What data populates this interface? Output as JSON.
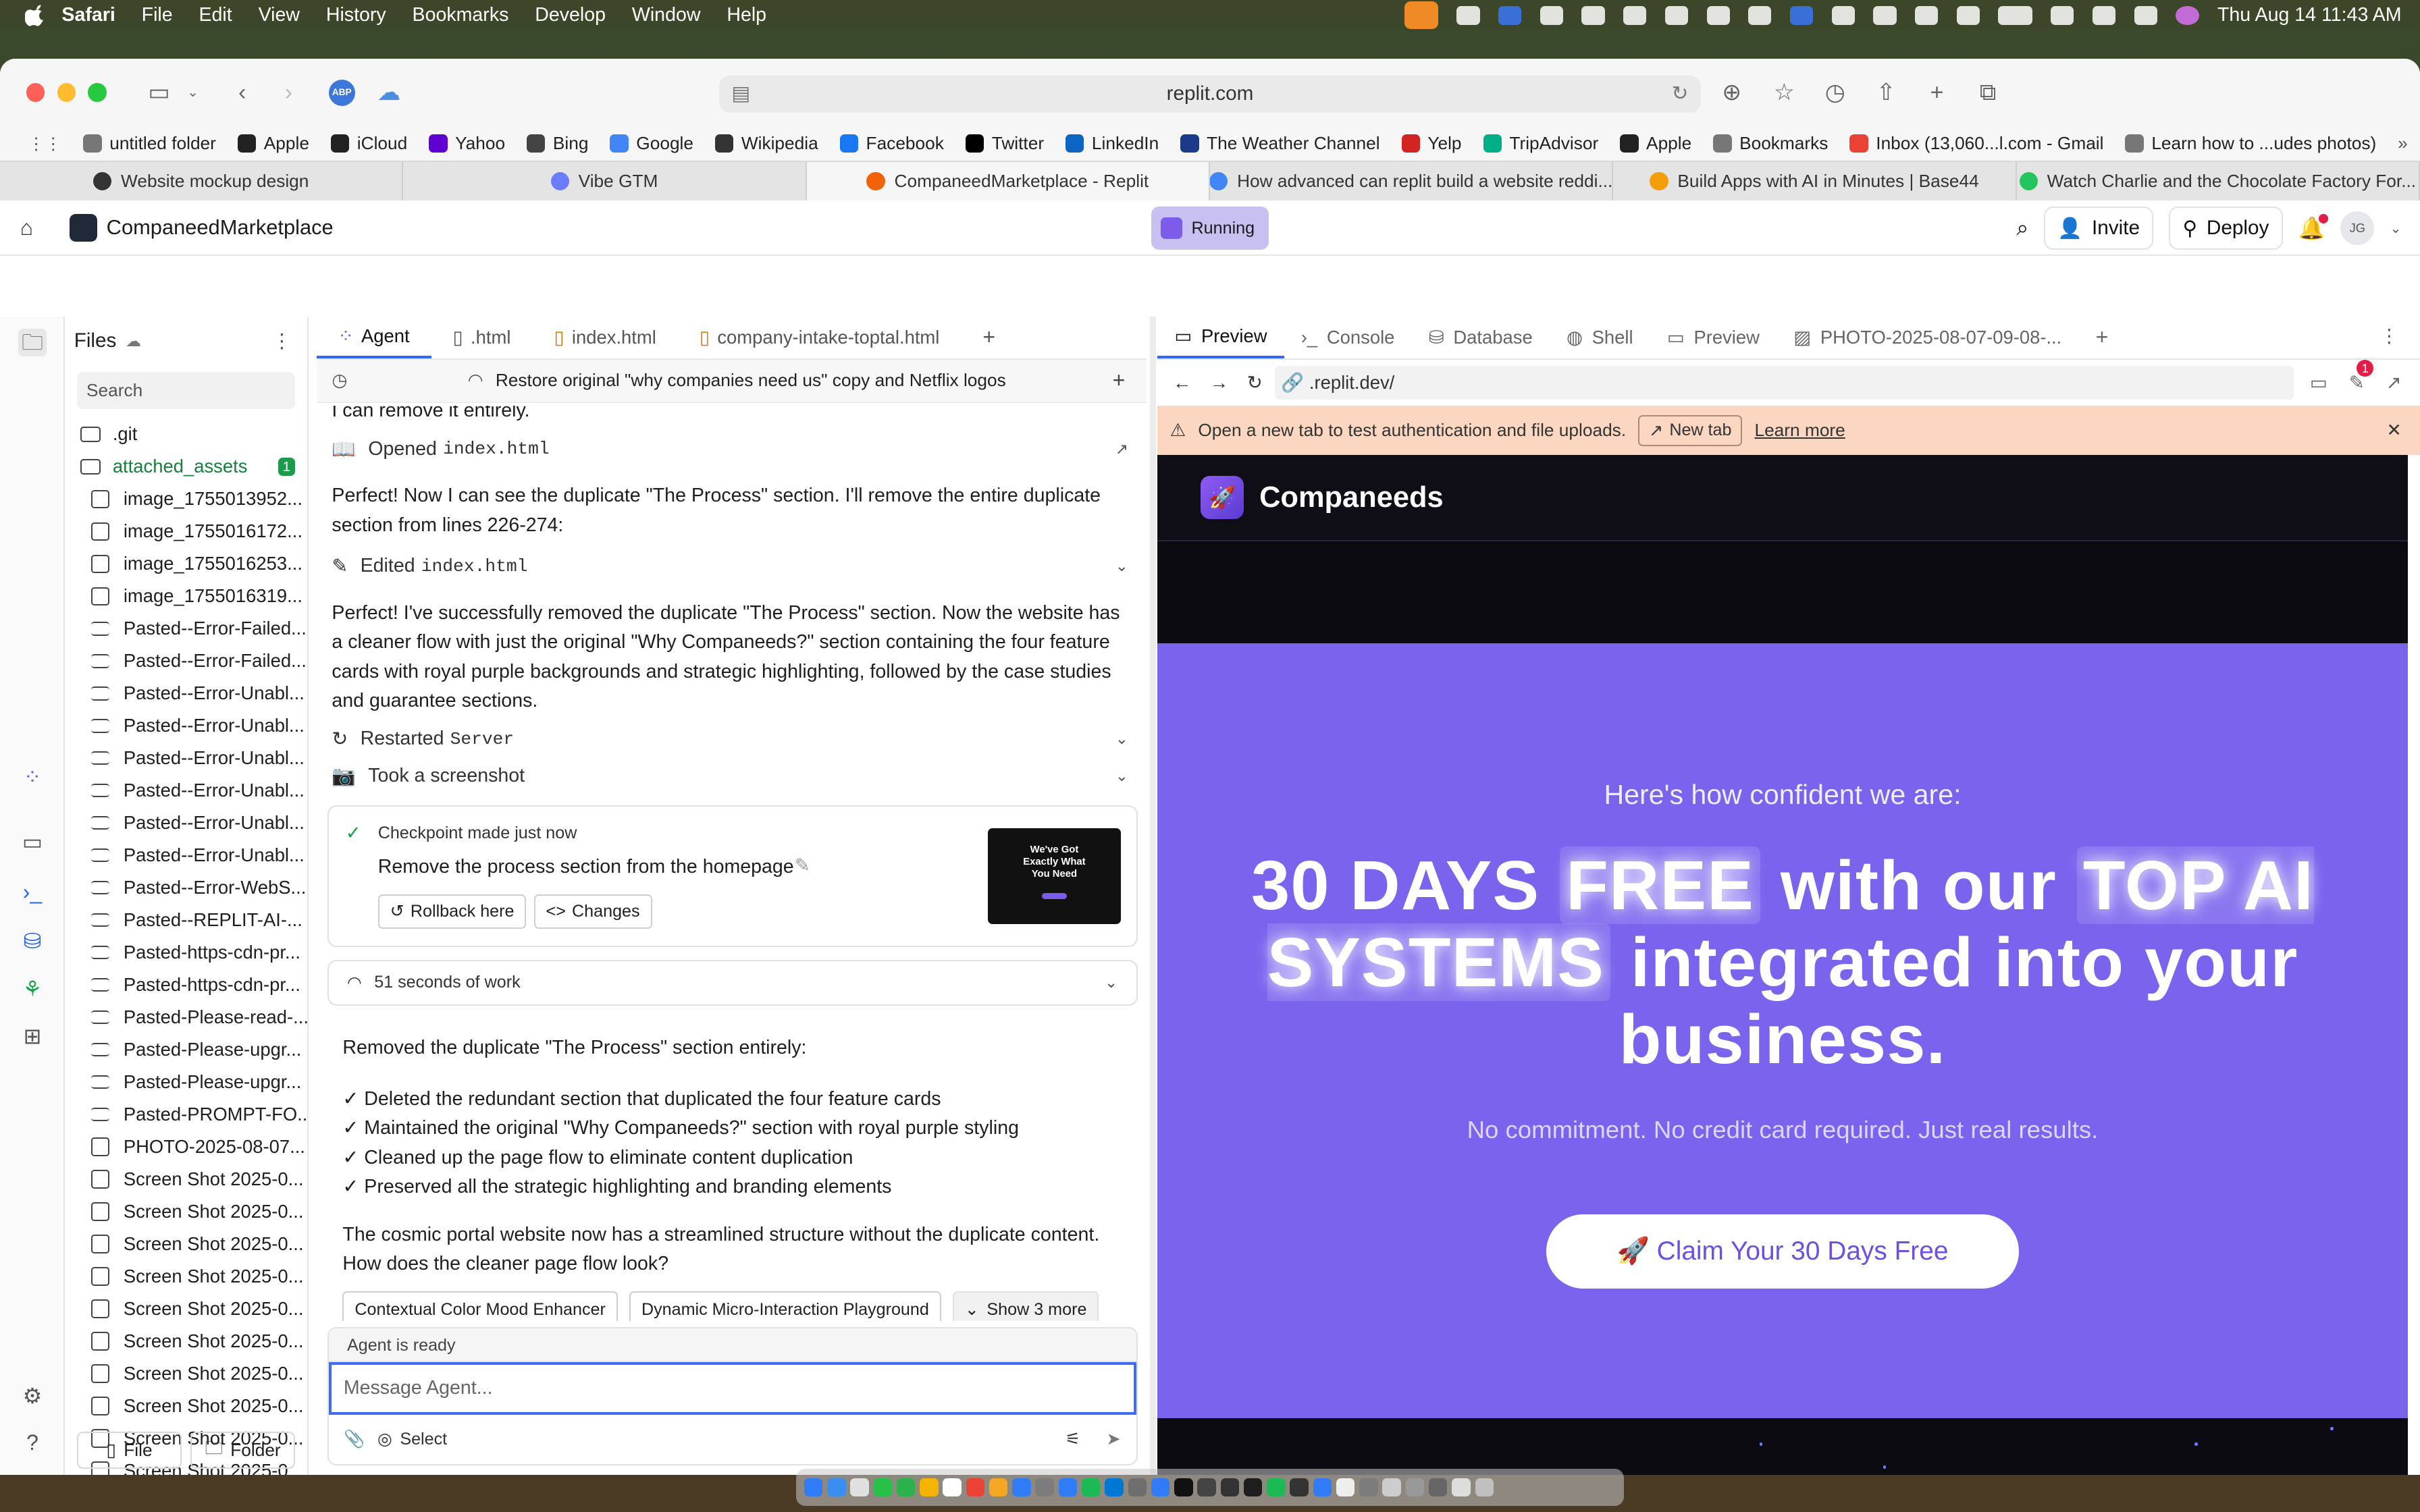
{
  "menubar": {
    "app": "Safari",
    "items": [
      "File",
      "Edit",
      "View",
      "History",
      "Bookmarks",
      "Develop",
      "Window",
      "Help"
    ],
    "clock": "Thu Aug 14  11:43 AM"
  },
  "safari": {
    "address": "replit.com",
    "abp_label": "ABP",
    "bookmarks": [
      {
        "label": "untitled folder",
        "color": "#777777"
      },
      {
        "label": "Apple",
        "color": "#222222"
      },
      {
        "label": "iCloud",
        "color": "#222222"
      },
      {
        "label": "Yahoo",
        "color": "#6001d2"
      },
      {
        "label": "Bing",
        "color": "#444444"
      },
      {
        "label": "Google",
        "color": "#4285f4"
      },
      {
        "label": "Wikipedia",
        "color": "#333333"
      },
      {
        "label": "Facebook",
        "color": "#1877f2"
      },
      {
        "label": "Twitter",
        "color": "#000000"
      },
      {
        "label": "LinkedIn",
        "color": "#0a66c2"
      },
      {
        "label": "The Weather Channel",
        "color": "#1b3a8a"
      },
      {
        "label": "Yelp",
        "color": "#d32323"
      },
      {
        "label": "TripAdvisor",
        "color": "#00af87"
      },
      {
        "label": "Apple",
        "color": "#222222"
      },
      {
        "label": "Bookmarks",
        "color": "#777777"
      },
      {
        "label": "Inbox (13,060...l.com - Gmail",
        "color": "#ea4335"
      },
      {
        "label": "Learn how to ...udes photos)",
        "color": "#777777"
      }
    ],
    "tabs": [
      {
        "label": "Website mockup design",
        "color": "#333333"
      },
      {
        "label": "Vibe GTM",
        "color": "#6b7cff"
      },
      {
        "label": "CompaneedMarketplace - Replit",
        "color": "#f26207"
      },
      {
        "label": "How advanced can replit build a website reddi...",
        "color": "#4285f4"
      },
      {
        "label": "Build Apps with AI in Minutes | Base44",
        "color": "#f59e0b"
      },
      {
        "label": "Watch Charlie and the Chocolate Factory For...",
        "color": "#22c55e"
      }
    ]
  },
  "replit": {
    "project": "CompaneedMarketplace",
    "status": "Running",
    "invite": "Invite",
    "deploy": "Deploy",
    "avatar": "JG",
    "files_title": "Files",
    "search_placeholder": "Search",
    "files": [
      {
        "name": ".git",
        "type": "folder"
      },
      {
        "name": "attached_assets",
        "type": "folder",
        "badge": "1"
      },
      {
        "name": "image_1755013952...",
        "type": "image"
      },
      {
        "name": "image_1755016172...",
        "type": "image"
      },
      {
        "name": "image_1755016253...",
        "type": "image"
      },
      {
        "name": "image_1755016319...",
        "type": "image"
      },
      {
        "name": "Pasted--Error-Failed...",
        "type": "text"
      },
      {
        "name": "Pasted--Error-Failed...",
        "type": "text"
      },
      {
        "name": "Pasted--Error-Unabl...",
        "type": "text"
      },
      {
        "name": "Pasted--Error-Unabl...",
        "type": "text"
      },
      {
        "name": "Pasted--Error-Unabl...",
        "type": "text"
      },
      {
        "name": "Pasted--Error-Unabl...",
        "type": "text"
      },
      {
        "name": "Pasted--Error-Unabl...",
        "type": "text"
      },
      {
        "name": "Pasted--Error-Unabl...",
        "type": "text"
      },
      {
        "name": "Pasted--Error-WebS...",
        "type": "text"
      },
      {
        "name": "Pasted--REPLIT-AI-...",
        "type": "text"
      },
      {
        "name": "Pasted-https-cdn-pr...",
        "type": "text"
      },
      {
        "name": "Pasted-https-cdn-pr...",
        "type": "text"
      },
      {
        "name": "Pasted-Please-read-...",
        "type": "text"
      },
      {
        "name": "Pasted-Please-upgr...",
        "type": "text"
      },
      {
        "name": "Pasted-Please-upgr...",
        "type": "text"
      },
      {
        "name": "Pasted-PROMPT-FO...",
        "type": "text"
      },
      {
        "name": "PHOTO-2025-08-07...",
        "type": "image"
      },
      {
        "name": "Screen Shot 2025-0...",
        "type": "image"
      },
      {
        "name": "Screen Shot 2025-0...",
        "type": "image"
      },
      {
        "name": "Screen Shot 2025-0...",
        "type": "image"
      },
      {
        "name": "Screen Shot 2025-0...",
        "type": "image"
      },
      {
        "name": "Screen Shot 2025-0...",
        "type": "image"
      },
      {
        "name": "Screen Shot 2025-0...",
        "type": "image"
      },
      {
        "name": "Screen Shot 2025-0...",
        "type": "image"
      },
      {
        "name": "Screen Shot 2025-0...",
        "type": "image"
      },
      {
        "name": "Screen Shot 2025-0...",
        "type": "image"
      },
      {
        "name": "Screen Shot 2025-0...",
        "type": "image"
      }
    ],
    "file_button": "File",
    "folder_button": "Folder",
    "agent_tabs": [
      "Agent",
      ".html",
      "index.html",
      "company-intake-toptal.html"
    ],
    "restore_text": "Restore original \"why companies need us\" copy and Netflix logos",
    "chat": {
      "cut_text": "I can remove it entirely.",
      "opened_label": "Opened",
      "opened_file": "index.html",
      "msg1": "Perfect! Now I can see the duplicate \"The Process\" section. I'll remove the entire duplicate section from lines 226-274:",
      "edited_label": "Edited",
      "edited_file": "index.html",
      "msg2": "Perfect! I've successfully removed the duplicate \"The Process\" section. Now the website has a cleaner flow with just the original \"Why Companeeds?\" section containing the four feature cards with royal purple backgrounds and strategic highlighting, followed by the case studies and guarantee sections.",
      "restarted_label": "Restarted",
      "restarted_target": "Server",
      "screenshot_label": "Took a screenshot",
      "checkpoint_label": "Checkpoint made just now",
      "checkpoint_title": "Remove the process section from the homepage",
      "rollback": "Rollback here",
      "changes": "Changes",
      "thumb_text": "We've Got Exactly What You Need",
      "work_label": "51 seconds of work",
      "summary_intro": "Removed the duplicate \"The Process\" section entirely:",
      "checks": [
        "✓ Deleted the redundant section that duplicated the four feature cards",
        "✓ Maintained the original \"Why Companeeds?\" section with royal purple styling",
        "✓ Cleaned up the page flow to eliminate content duplication",
        "✓ Preserved all the strategic highlighting and branding elements"
      ],
      "closing": "The cosmic portal website now has a streamlined structure without the duplicate content. How does the cleaner page flow look?",
      "chips": [
        "Contextual Color Mood Enhancer",
        "Dynamic Micro-Interaction Playground",
        "Show 3 more"
      ]
    },
    "agent_ready": "Agent is ready",
    "message_placeholder": "Message Agent...",
    "select_label": "Select",
    "preview_tabs": [
      "Preview",
      "Console",
      "Database",
      "Shell",
      "Preview",
      "PHOTO-2025-08-07-09-08-..."
    ],
    "preview_url": ".replit.dev/",
    "notify_count": "1",
    "warning_text": "Open a new tab to test authentication and file uploads.",
    "new_tab_label": "New tab",
    "learn_more": "Learn more"
  },
  "site": {
    "brand": "Companeeds",
    "hero_sub": "Here's how confident we are:",
    "hero_h_1": "30 DAYS ",
    "hero_h_hl1": "FREE",
    "hero_h_2": " with our ",
    "hero_h_hl2": "TOP AI SYSTEMS",
    "hero_h_3": " integrated into your business.",
    "hero_p": "No commitment. No credit card required. Just real results.",
    "cta": "🚀 Claim Your 30 Days Free"
  },
  "colors": {
    "hero_bg": "#7c63ee",
    "accent": "#3366ff",
    "running_bg": "#c9c0f2",
    "warning_bg": "#fbd7c2"
  }
}
